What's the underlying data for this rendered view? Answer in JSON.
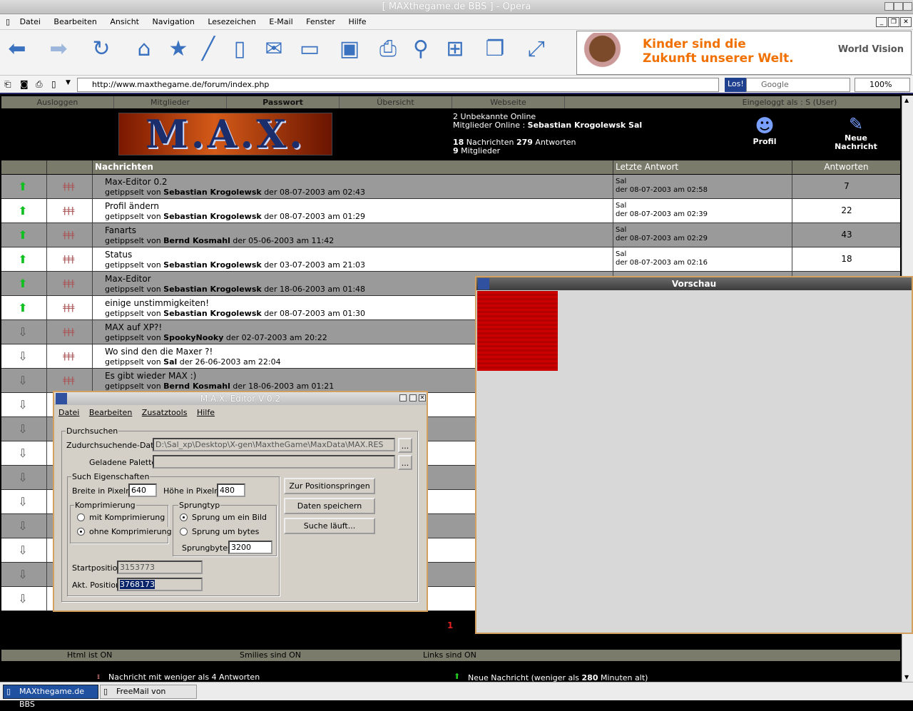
{
  "window": {
    "title": "[ MAXthegame.de BBS ] - Opera"
  },
  "menu": [
    "Datei",
    "Bearbeiten",
    "Ansicht",
    "Navigation",
    "Lesezeichen",
    "E-Mail",
    "Fenster",
    "Hilfe"
  ],
  "banner": {
    "line1": "Kinder sind die",
    "line2": "Zukunft unserer Welt.",
    "brand": "World Vision"
  },
  "address": {
    "url": "http://www.maxthegame.de/forum/index.php",
    "go": "Los!",
    "search": "Google",
    "zoom": "100%"
  },
  "forum_nav": {
    "logout": "Ausloggen",
    "members": "Mitglieder",
    "password": "Passwort",
    "overview": "Übersicht",
    "website": "Webseite",
    "logged_in": "Eingeloggt als : S (User)"
  },
  "logo": "M.A.X.",
  "online": {
    "line1": "2 Unbekannte Online",
    "line2_prefix": "Mitglieder Online : ",
    "line2_names": "Sebastian Krogolewsk Sal",
    "msgs": "18",
    "msgs_label": " Nachrichten ",
    "answers": "279",
    "answers_label": " Antworten",
    "members": "9",
    "members_label": " Mitglieder"
  },
  "profile": {
    "label": "Profil"
  },
  "new_message": {
    "line1": "Neue",
    "line2": "Nachricht"
  },
  "table_headers": {
    "messages": "Nachrichten",
    "last_reply": "Letzte Antwort",
    "answers": "Antworten"
  },
  "threads": [
    {
      "title": "Max-Editor 0.2",
      "by": "getippselt von ",
      "author": "Sebastian Krogolewsk",
      "date": " der 08-07-2003 am 02:43",
      "last_user": "Sal",
      "last_date": "der 08-07-2003 am 02:58",
      "count": "7",
      "new": true
    },
    {
      "title": "Profil ändern",
      "by": "getippselt von ",
      "author": "Sebastian Krogolewsk",
      "date": " der 08-07-2003 am 01:29",
      "last_user": "Sal",
      "last_date": "der 08-07-2003 am 02:39",
      "count": "22",
      "new": true
    },
    {
      "title": "Fanarts",
      "by": "getippselt von ",
      "author": "Bernd Kosmahl",
      "date": " der 05-06-2003 am 11:42",
      "last_user": "Sal",
      "last_date": "der 08-07-2003 am 02:29",
      "count": "43",
      "new": true
    },
    {
      "title": "Status",
      "by": "getippselt von ",
      "author": "Sebastian Krogolewsk",
      "date": " der 03-07-2003 am 21:03",
      "last_user": "Sal",
      "last_date": "der 08-07-2003 am 02:16",
      "count": "18",
      "new": true
    },
    {
      "title": "Max-Editor",
      "by": "getippselt von ",
      "author": "Sebastian Krogolewsk",
      "date": " der 18-06-2003 am 01:48",
      "last_user": "",
      "last_date": "",
      "count": "",
      "new": true
    },
    {
      "title": "einige unstimmigkeiten!",
      "by": "getippselt von ",
      "author": "Sebastian Krogolewsk",
      "date": " der 08-07-2003 am 01:30",
      "last_user": "",
      "last_date": "",
      "count": "",
      "new": true
    },
    {
      "title": "MAX auf XP?!",
      "by": "getippselt von ",
      "author": "SpookyNooky",
      "date": " der 02-07-2003 am 20:22",
      "last_user": "",
      "last_date": "",
      "count": "",
      "new": false
    },
    {
      "title": "Wo sind den die Maxer ?!",
      "by": "getippselt von ",
      "author": "Sal",
      "date": " der 26-06-2003 am 22:04",
      "last_user": "",
      "last_date": "",
      "count": "",
      "new": false
    },
    {
      "title": "Es gibt wieder MAX :)",
      "by": "getippselt von ",
      "author": "Bernd Kosmahl",
      "date": " der 18-06-2003 am 01:21",
      "last_user": "",
      "last_date": "",
      "count": "",
      "new": false
    }
  ],
  "page_number": "1",
  "status": {
    "html": "Html ist ON",
    "smilies": "Smilies sind ON",
    "links": "Links sind ON"
  },
  "legend": {
    "old_prefix": "Nachricht mit weniger als 4 Antworten",
    "new_prefix": "Neue Nachricht (weniger als ",
    "new_minutes": "280",
    "new_suffix": " Minuten alt)"
  },
  "preview": {
    "title": "Vorschau"
  },
  "editor": {
    "title": "M.A.X. Editor V 0.2",
    "menu": [
      "Datei",
      "Bearbeiten",
      "Zusatztools",
      "Hilfe"
    ],
    "group_search": "Durchsuchen",
    "file_label": "Zudurchsuchende-Datei:",
    "file_value": "D:\\Sal_xp\\Desktop\\X-gen\\MaxtheGame\\MaxData\\MAX.RES",
    "palette_label": "Geladene Palette:",
    "browse": "...",
    "group_props": "Such Eigenschaften",
    "width_label": "Breite in Pixeln:",
    "width_value": "640",
    "height_label": "Höhe in Pixeln:",
    "height_value": "480",
    "group_compress": "Komprimierung",
    "with_compress": "mit Komprimierung",
    "without_compress": "ohne Komprimierung",
    "group_jump": "Sprungtyp",
    "jump_image": "Sprung um ein Bild",
    "jump_bytes": "Sprung um bytes",
    "jump_bytes_label": "Sprungbytes:",
    "jump_bytes_value": "3200",
    "btn_position": "Zur Positionspringen",
    "btn_save": "Daten speichern",
    "btn_search": "Suche läuft...",
    "start_label": "Startposition:",
    "start_value": "3153773",
    "current_label": "Akt. Position:",
    "current_value": "3768173"
  },
  "taskbar": [
    "MAXthegame.de BBS",
    "FreeMail von WEB.DE"
  ]
}
